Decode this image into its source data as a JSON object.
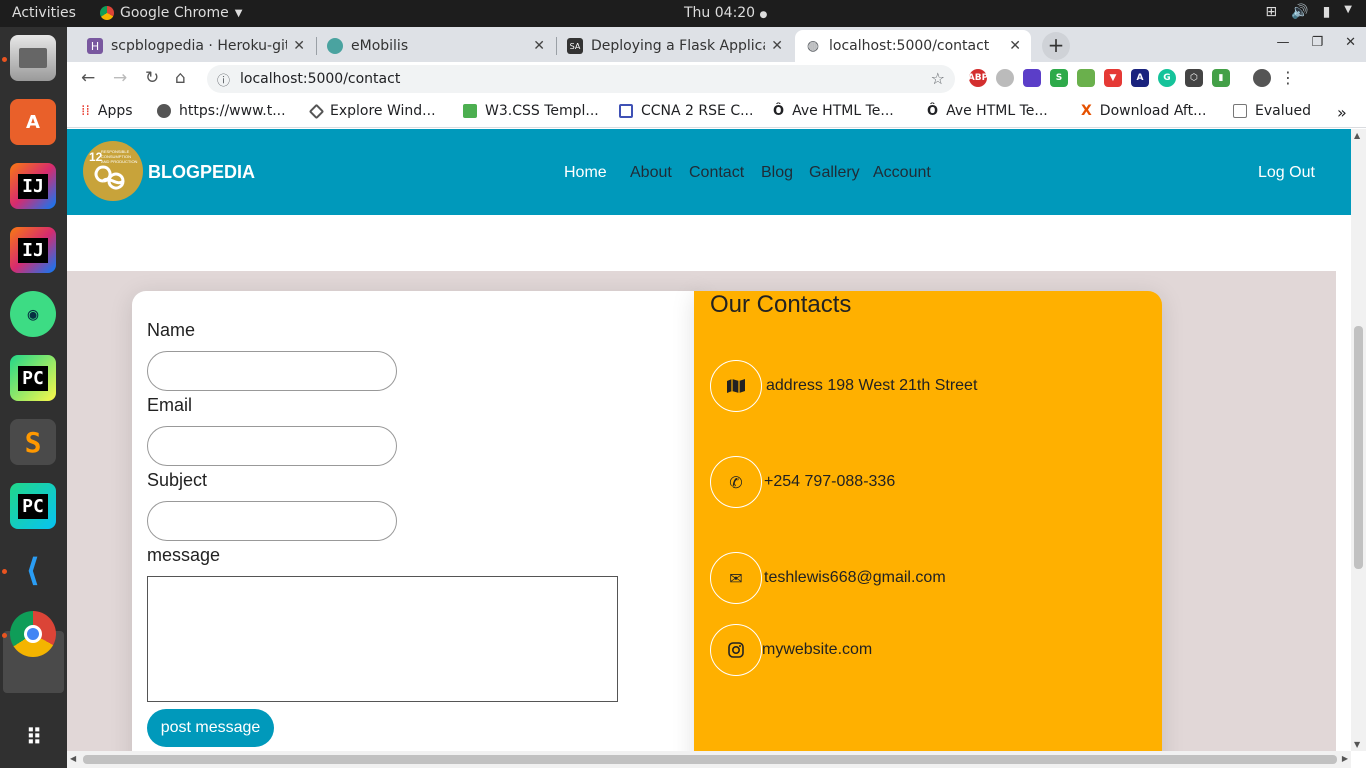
{
  "topbar": {
    "activities": "Activities",
    "app_name": "Google Chrome",
    "clock": "Thu 04:20"
  },
  "dock": {
    "apps": [
      "files-icon",
      "app-store-icon",
      "intellij-icon",
      "intellij-icon",
      "android-studio-icon",
      "pycharm-icon",
      "sublime-text-icon",
      "pycharm-icon",
      "vscode-icon",
      "chrome-icon",
      "app-grid-icon"
    ]
  },
  "browser": {
    "tabs": [
      {
        "title": "scpblogpedia · Heroku-git",
        "icon": "heroku-icon"
      },
      {
        "title": "eMobilis",
        "icon": "emobilis-icon"
      },
      {
        "title": "Deploying a Flask Applica",
        "icon": "sa-icon"
      },
      {
        "title": "localhost:5000/contact",
        "icon": "globe-icon",
        "active": true
      }
    ],
    "url": "localhost:5000/contact",
    "bookmarks": [
      {
        "label": "Apps"
      },
      {
        "label": "https://www.t..."
      },
      {
        "label": "Explore Wind..."
      },
      {
        "label": "W3.CSS Templ..."
      },
      {
        "label": "CCNA 2 RSE C..."
      },
      {
        "label": "Ave HTML Te..."
      },
      {
        "label": "Ave HTML Te..."
      },
      {
        "label": "Download Aft..."
      },
      {
        "label": "Evalued"
      }
    ]
  },
  "site": {
    "logo_text": "12 RESPONSIBLE CONSUMPTION AND PRODUCTION",
    "brand": "BLOGPEDIA",
    "nav": {
      "home": "Home",
      "about": "About",
      "contact": "Contact",
      "blog": "Blog",
      "gallery": "Gallery",
      "account": "Account",
      "logout": "Log Out"
    },
    "form": {
      "name_label": "Name",
      "email_label": "Email",
      "subject_label": "Subject",
      "message_label": "message",
      "submit_label": "post message"
    },
    "contacts": {
      "title": "Our Contacts",
      "address": "address 198 West 21th Street",
      "phone": "+254 797-088-336",
      "email": "teshlewis668@gmail.com",
      "website": "mywebsite.com"
    }
  },
  "colors": {
    "brand_teal": "#0099bb",
    "contact_yellow": "#ffb000",
    "section_bg": "#e1d7d7"
  }
}
